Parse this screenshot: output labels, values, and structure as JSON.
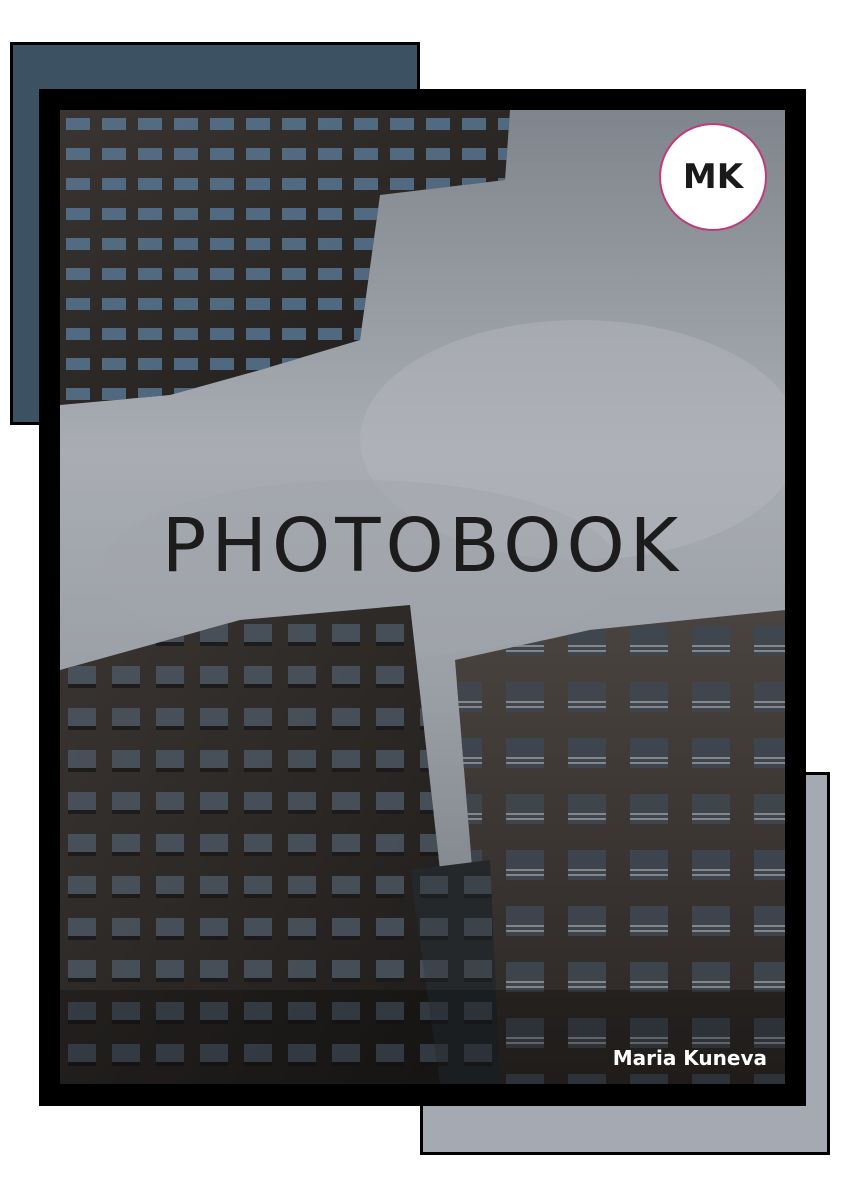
{
  "cover": {
    "title": "PHOTOBOOK",
    "monogram": "MK",
    "author": "Maria Kuneva"
  },
  "colors": {
    "deco_top": "#3c5262",
    "deco_bottom": "#a5a9b2",
    "frame": "#000000",
    "badge_border": "#c2387a"
  },
  "image": {
    "subject": "building-facades-icon"
  }
}
